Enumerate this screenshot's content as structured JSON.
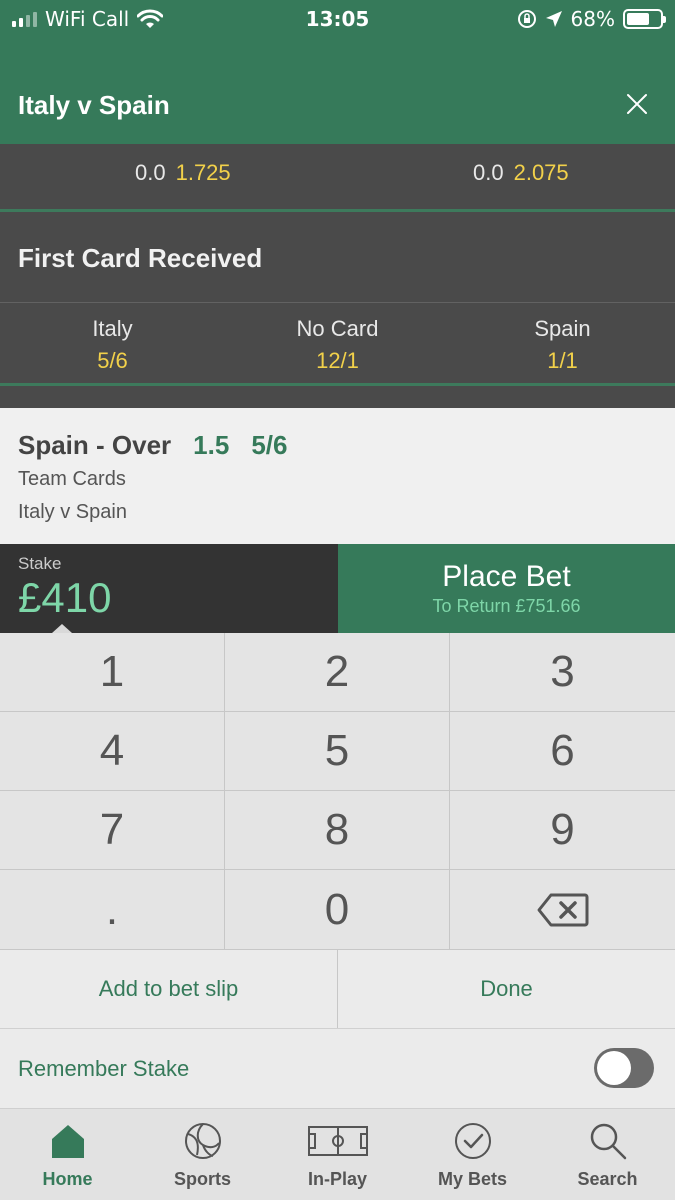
{
  "status_bar": {
    "carrier": "WiFi Call",
    "time": "13:05",
    "battery": "68%",
    "battery_level": 0.68
  },
  "header": {
    "title": "Italy v Spain"
  },
  "handicap_row": [
    {
      "line": "0.0",
      "price": "1.725"
    },
    {
      "line": "0.0",
      "price": "2.075"
    }
  ],
  "market": {
    "title": "First Card Received",
    "options": [
      {
        "name": "Italy",
        "price": "5/6"
      },
      {
        "name": "No Card",
        "price": "12/1"
      },
      {
        "name": "Spain",
        "price": "1/1"
      }
    ]
  },
  "selection": {
    "name": "Spain - Over",
    "handicap": "1.5",
    "odds": "5/6",
    "market": "Team Cards",
    "event": "Italy v Spain"
  },
  "stake": {
    "label": "Stake",
    "value": "£410"
  },
  "place_bet": {
    "label": "Place Bet",
    "to_return": "To Return £751.66"
  },
  "keypad": {
    "keys": [
      "1",
      "2",
      "3",
      "4",
      "5",
      "6",
      "7",
      "8",
      "9",
      ".",
      "0"
    ]
  },
  "actions": {
    "add_to_slip": "Add to bet slip",
    "done": "Done"
  },
  "remember_stake": {
    "label": "Remember Stake",
    "enabled": false
  },
  "tabs": [
    {
      "label": "Home",
      "icon": "home-icon",
      "active": true
    },
    {
      "label": "Sports",
      "icon": "ball-icon",
      "active": false
    },
    {
      "label": "In-Play",
      "icon": "pitch-icon",
      "active": false
    },
    {
      "label": "My Bets",
      "icon": "check-circle-icon",
      "active": false
    },
    {
      "label": "Search",
      "icon": "search-icon",
      "active": false
    }
  ],
  "colors": {
    "brand_green": "#367a5a",
    "odds_yellow": "#f2d14a",
    "stake_green": "#7ed6a8",
    "dark_panel": "#4a4a4a"
  }
}
